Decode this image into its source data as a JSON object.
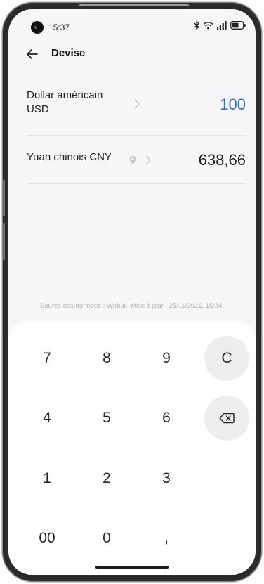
{
  "status_bar": {
    "time": "15:37",
    "icons": [
      "bluetooth-icon",
      "wifi-icon",
      "signal-icon",
      "battery-icon"
    ]
  },
  "header": {
    "title": "Devise",
    "back_icon": "arrow-left-icon"
  },
  "currencies": [
    {
      "name": "Dollar américain USD",
      "amount": "100",
      "active": true,
      "amount_color": "#2f6ed4"
    },
    {
      "name": "Yuan chinois CNY",
      "amount": "638,66",
      "active": false,
      "amount_color": "#222222"
    }
  ],
  "source_text": "Source des données : Webull. Mise à jour : 25/11/2021, 15:34.",
  "keypad": {
    "keys": [
      "7",
      "8",
      "9",
      "C",
      "4",
      "5",
      "6",
      "1",
      "2",
      "3",
      "00",
      "0",
      ","
    ],
    "delete_icon": "backspace-icon",
    "clear_label": "C"
  },
  "colors": {
    "accent": "#2f6ed4",
    "background": "#f7f7f9",
    "keypad_background": "#ffffff",
    "round_key": "#eeeef0"
  }
}
